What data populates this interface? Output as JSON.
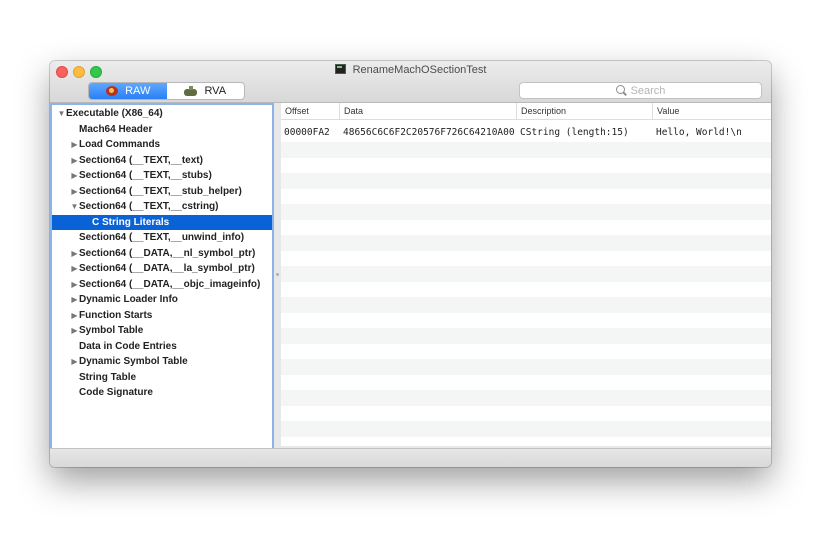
{
  "window": {
    "title": "RenameMachOSectionTest"
  },
  "toolbar": {
    "segments": [
      {
        "label": "RAW",
        "icon": "raw-icon",
        "selected": true
      },
      {
        "label": "RVA",
        "icon": "rva-icon",
        "selected": false
      }
    ],
    "search_placeholder": "Search"
  },
  "tree": [
    {
      "label": "Executable  (X86_64)",
      "expanded": true
    },
    {
      "label": "Mach64 Header"
    },
    {
      "label": "Load Commands",
      "collapsed": true
    },
    {
      "label": "Section64 (__TEXT,__text)",
      "collapsed": true
    },
    {
      "label": "Section64 (__TEXT,__stubs)",
      "collapsed": true
    },
    {
      "label": "Section64 (__TEXT,__stub_helper)",
      "collapsed": true
    },
    {
      "label": "Section64 (__TEXT,__cstring)",
      "expanded": true
    },
    {
      "label": "C String Literals",
      "selected": true
    },
    {
      "label": "Section64 (__TEXT,__unwind_info)"
    },
    {
      "label": "Section64 (__DATA,__nl_symbol_ptr)",
      "collapsed": true
    },
    {
      "label": "Section64 (__DATA,__la_symbol_ptr)",
      "collapsed": true
    },
    {
      "label": "Section64 (__DATA,__objc_imageinfo)",
      "collapsed": true
    },
    {
      "label": "Dynamic Loader Info",
      "collapsed": true
    },
    {
      "label": "Function Starts",
      "collapsed": true
    },
    {
      "label": "Symbol Table",
      "collapsed": true
    },
    {
      "label": "Data in Code Entries"
    },
    {
      "label": "Dynamic Symbol Table",
      "collapsed": true
    },
    {
      "label": "String Table"
    },
    {
      "label": "Code Signature"
    }
  ],
  "table": {
    "columns": [
      "Offset",
      "Data",
      "Description",
      "Value"
    ],
    "rows": [
      [
        "00000FA2",
        "48656C6C6F2C20576F726C64210A00",
        "CString (length:15)",
        "Hello, World!\\n"
      ]
    ]
  },
  "colors": {
    "selection": "#0a63d6",
    "segment_active": "#2a7ff5",
    "sidebar_focus_ring": "#8db4e8",
    "traffic_close": "#fc605c",
    "traffic_minimize": "#fdbc40",
    "traffic_zoom": "#34c84a"
  }
}
